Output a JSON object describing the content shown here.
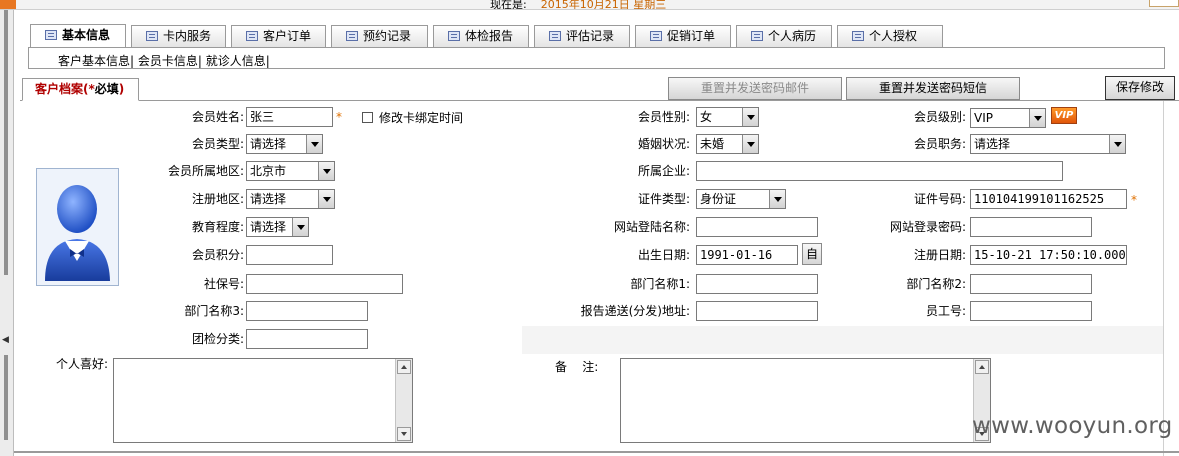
{
  "header": {
    "now_label": "现在是:",
    "now_value": "2015年10月21日 星期三"
  },
  "tabs": [
    {
      "label": "基本信息",
      "active": true
    },
    {
      "label": "卡内服务"
    },
    {
      "label": "客户订单"
    },
    {
      "label": "预约记录"
    },
    {
      "label": "体检报告"
    },
    {
      "label": "评估记录"
    },
    {
      "label": "促销订单"
    },
    {
      "label": "个人病历"
    },
    {
      "label": "个人授权"
    }
  ],
  "sublinks": "客户基本信息| 会员卡信息| 就诊人信息|",
  "section": {
    "label": "客户档案(",
    "req_mark": "*",
    "req_text": "必填",
    "close": ")"
  },
  "buttons": {
    "reset_email": "重置并发送密码邮件",
    "reset_sms": "重置并发送密码短信",
    "save": "保存修改",
    "date_picker": "自"
  },
  "form": {
    "name": {
      "label": "会员姓名:",
      "value": "张三"
    },
    "bind_time": {
      "label": "修改卡绑定时间"
    },
    "gender": {
      "label": "会员性别:",
      "value": "女"
    },
    "level": {
      "label": "会员级别:",
      "value": "VIP",
      "badge": "VIP"
    },
    "member_type": {
      "label": "会员类型:",
      "value": "请选择"
    },
    "marital": {
      "label": "婚姻状况:",
      "value": "未婚"
    },
    "position": {
      "label": "会员职务:",
      "value": "请选择"
    },
    "region": {
      "label": "会员所属地区:",
      "value": "北京市"
    },
    "company": {
      "label": "所属企业:",
      "value": ""
    },
    "reg_region": {
      "label": "注册地区:",
      "value": "请选择"
    },
    "id_type": {
      "label": "证件类型:",
      "value": "身份证"
    },
    "id_no": {
      "label": "证件号码:",
      "value": "110104199101162525"
    },
    "education": {
      "label": "教育程度:",
      "value": "请选择"
    },
    "site_login": {
      "label": "网站登陆名称:",
      "value": ""
    },
    "site_pwd": {
      "label": "网站登录密码:",
      "value": ""
    },
    "points": {
      "label": "会员积分:",
      "value": ""
    },
    "birth": {
      "label": "出生日期:",
      "value": "1991-01-16"
    },
    "reg_date": {
      "label": "注册日期:",
      "value": "15-10-21 17:50:10.000"
    },
    "social": {
      "label": "社保号:",
      "value": ""
    },
    "dept1": {
      "label": "部门名称1:",
      "value": ""
    },
    "dept2": {
      "label": "部门名称2:",
      "value": ""
    },
    "dept3": {
      "label": "部门名称3:",
      "value": ""
    },
    "report_addr": {
      "label": "报告递送(分发)地址:",
      "value": ""
    },
    "emp_no": {
      "label": "员工号:",
      "value": ""
    },
    "group_cat": {
      "label": "团检分类:",
      "value": ""
    },
    "hobby": {
      "label": "个人喜好:"
    },
    "remark": {
      "label": "备    注:"
    }
  },
  "required_mark": "*",
  "watermark": "www.wooyun.org",
  "colors": {
    "required": "#e07000",
    "section_title": "#b00000",
    "vip_badge": "#f07a20"
  }
}
